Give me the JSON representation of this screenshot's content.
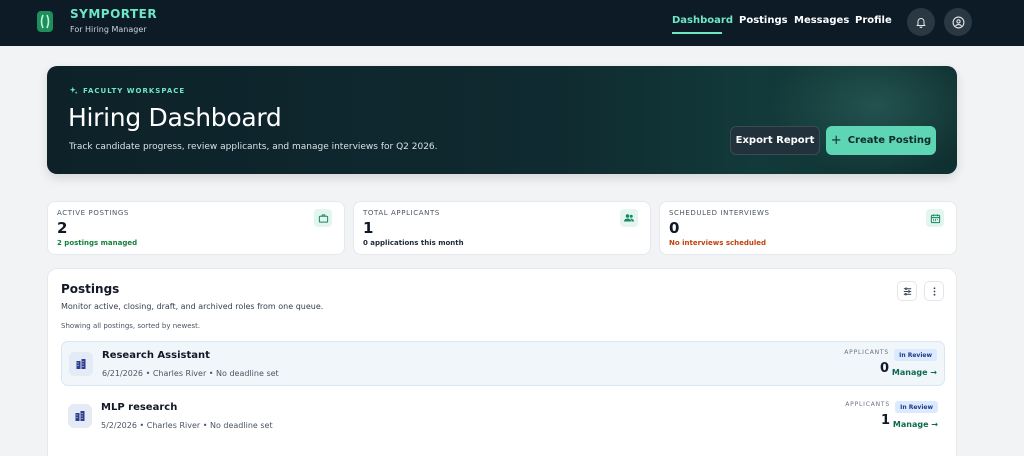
{
  "app": {
    "brand": "SYMPORTER",
    "subtitle": "For Hiring Manager",
    "accent": "#6ee7c4"
  },
  "nav": {
    "links": [
      {
        "label": "Dashboard",
        "active": true
      },
      {
        "label": "Postings",
        "active": false
      },
      {
        "label": "Messages",
        "active": false
      },
      {
        "label": "Profile",
        "active": false
      }
    ],
    "icons": [
      "bell-icon",
      "user-circle-icon"
    ]
  },
  "hero": {
    "eyebrow": "FACULTY WORKSPACE",
    "title": "Hiring Dashboard",
    "subtitle": "Track candidate progress, review applicants, and manage interviews for Q2 2026.",
    "export_label": "Export Report",
    "create_label": "Create Posting"
  },
  "stats": [
    {
      "label": "ACTIVE POSTINGS",
      "value": "2",
      "note": "2 postings managed",
      "note_color": "#15803d",
      "icon": "briefcase-icon"
    },
    {
      "label": "TOTAL APPLICANTS",
      "value": "1",
      "note": "0 applications this month",
      "note_color": "#1f2937",
      "icon": "users-icon"
    },
    {
      "label": "SCHEDULED INTERVIEWS",
      "value": "0",
      "note": "No interviews scheduled",
      "note_color": "#c2410c",
      "icon": "calendar-icon"
    }
  ],
  "postings": {
    "title": "Postings",
    "description": "Monitor active, closing, draft, and archived roles from one queue.",
    "note": "Showing all postings, sorted by newest.",
    "items": [
      {
        "title": "Research Assistant",
        "meta": "6/21/2026 • Charles River • No deadline set",
        "applicants_label": "APPLICANTS",
        "applicants": "0",
        "status": "In Review",
        "manage": "Manage →"
      },
      {
        "title": "MLP research",
        "meta": "5/2/2026 • Charles River • No deadline set",
        "applicants_label": "APPLICANTS",
        "applicants": "1",
        "status": "In Review",
        "manage": "Manage →"
      }
    ]
  }
}
